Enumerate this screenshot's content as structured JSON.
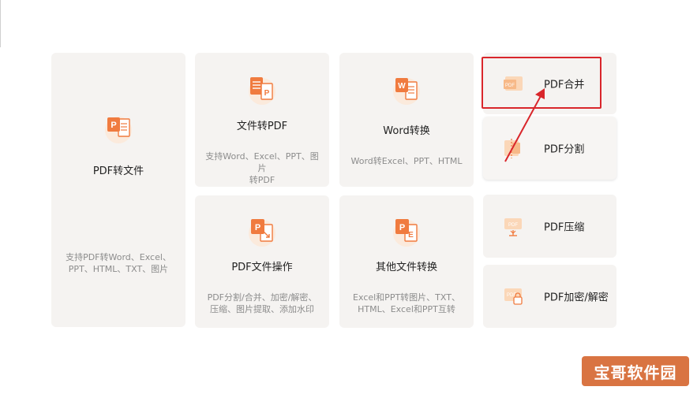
{
  "cards": {
    "pdf_to_file": {
      "title": "PDF转文件",
      "desc": "支持PDF转Word、Excel、\nPPT、HTML、TXT、图片"
    },
    "file_to_pdf": {
      "title": "文件转PDF",
      "desc": "支持Word、Excel、PPT、图片\n转PDF"
    },
    "word_convert": {
      "title": "Word转换",
      "desc": "Word转Excel、PPT、HTML"
    },
    "pdf_operations": {
      "title": "PDF文件操作",
      "desc": "PDF分割/合并、加密/解密、\n压缩、图片提取、添加水印"
    },
    "other_convert": {
      "title": "其他文件转换",
      "desc": "Excel和PPT转图片、TXT、\nHTML、Excel和PPT互转"
    }
  },
  "tools": {
    "merge": {
      "label": "PDF合并"
    },
    "split": {
      "label": "PDF分割"
    },
    "compress": {
      "label": "PDF压缩"
    },
    "encrypt": {
      "label": "PDF加密/解密"
    }
  },
  "icons": {
    "pdf_to_file": "pdf-to-file-icon",
    "file_to_pdf": "file-to-pdf-icon",
    "word_convert": "word-icon",
    "pdf_operations": "pdf-operations-icon",
    "other_convert": "other-convert-icon",
    "merge": "pdf-merge-icon",
    "split": "pdf-split-icon",
    "compress": "pdf-compress-icon",
    "encrypt": "pdf-lock-icon"
  },
  "colors": {
    "card_bg": "#f5f3f1",
    "icon_orange": "#f07b3f",
    "icon_light": "#fbd7b8",
    "highlight_red": "#d9262b",
    "watermark_bg": "#d66832"
  },
  "watermark": {
    "text": "宝哥软件园"
  }
}
